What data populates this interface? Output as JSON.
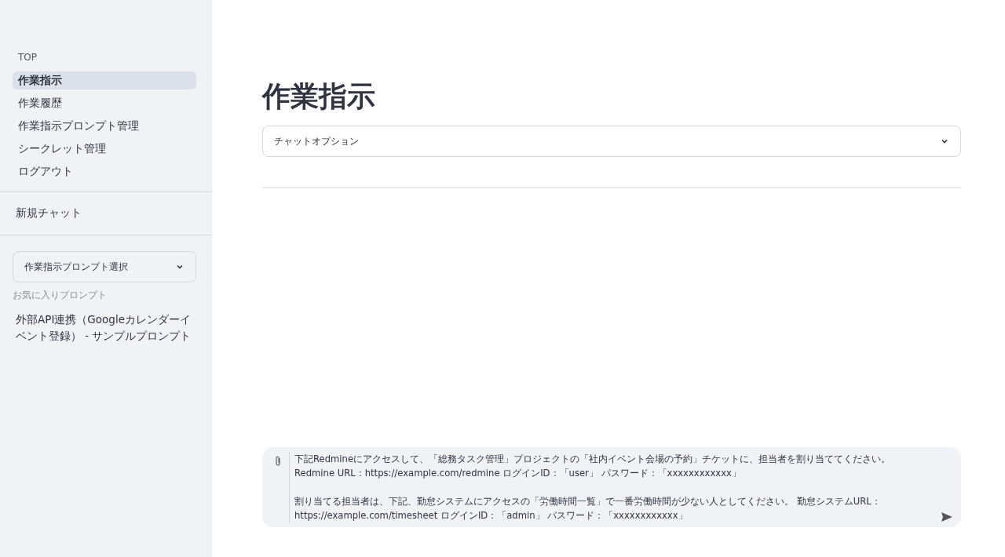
{
  "sidebar": {
    "nav_items": [
      {
        "label": "TOP",
        "kind": "header",
        "selected": false
      },
      {
        "label": "作業指示",
        "kind": "link",
        "selected": true
      },
      {
        "label": "作業履歴",
        "kind": "link",
        "selected": false
      },
      {
        "label": "作業指示プロンプト管理",
        "kind": "link",
        "selected": false
      },
      {
        "label": "シークレット管理",
        "kind": "link",
        "selected": false
      },
      {
        "label": "ログアウト",
        "kind": "link",
        "selected": false
      }
    ],
    "new_chat": "新規チャット",
    "prompt_select": {
      "value": "作業指示プロンプト選択"
    },
    "favorites_label": "お気に入りプロンプト",
    "favorites": [
      "外部API連携（Googleカレンダーイベント登録） - サンプルプロンプト"
    ]
  },
  "main": {
    "title": "作業指示",
    "chat_options": {
      "label": "チャットオプション",
      "expanded": false
    },
    "chat_input": {
      "paragraphs": [
        [
          "下記Redmineにアクセスして、「総務タスク管理」プロジェクトの「社内イベント会場の予約」チケットに、担当者を割り当ててください。",
          "Redmine URL：https://example.com/redmine ログインID：「user」 パスワード：「xxxxxxxxxxxx」"
        ],
        [
          "割り当てる担当者は、下記、勤怠システムにアクセスの「労働時間一覧」で一番労働時間が少ない人としてください。 勤怠システムURL：",
          "https://example.com/timesheet ログインID：「admin」 パスワード：「xxxxxxxxxxxx」"
        ]
      ]
    }
  }
}
